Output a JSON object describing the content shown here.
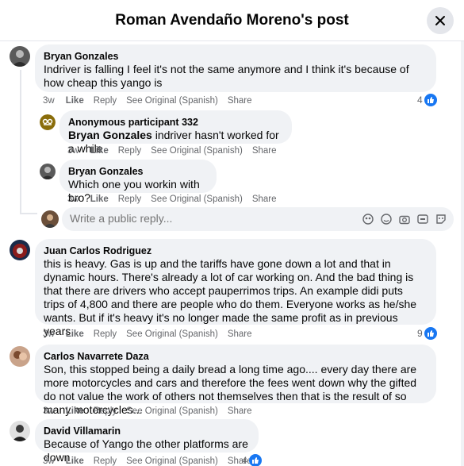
{
  "header": {
    "title": "Roman Avendaño Moreno's post"
  },
  "actions": {
    "like": "Like",
    "reply": "Reply",
    "see_original": "See Original (Spanish)",
    "share": "Share"
  },
  "reply_box": {
    "placeholder": "Write a public reply..."
  },
  "comments": [
    {
      "author": "Bryan Gonzales",
      "text": "Indriver is falling I feel it's not the same anymore and I think it's because of how cheap this yango is",
      "time": "3w",
      "reactions": "4"
    },
    {
      "author": "Anonymous participant 332",
      "mention": "Bryan Gonzales",
      "text": " indriver hasn't worked for a while",
      "time": "3w"
    },
    {
      "author": "Bryan Gonzales",
      "text": "Which one you workin with bro?",
      "time": "3w"
    },
    {
      "author": "Juan Carlos Rodriguez",
      "text": "this is heavy. Gas is up and the tariffs have gone down a lot and that in dynamic hours. There's already a lot of car working on. And the bad thing is that there are drivers who accept pauperrimos trips. An example didi puts trips of 4,800 and there are people who do them. Everyone works as he/she wants. But if it's heavy it's no longer made the same profit as in previous years",
      "time": "3w",
      "reactions": "9"
    },
    {
      "author": "Carlos Navarrete Daza",
      "text": "Son, this stopped being a daily bread a long time ago.... every day there are more motorcycles and cars and therefore the fees went down why the gifted do not value the work of others not themselves then that is the result of so many motorcycles...",
      "time": "3w"
    },
    {
      "author": "David Villamarin",
      "text": "Because of Yango the other platforms are down",
      "time": "3w",
      "reactions": "4"
    }
  ],
  "colors": {
    "accent": "#1877f2",
    "bubble": "#f0f2f5",
    "meta": "#65676b"
  }
}
